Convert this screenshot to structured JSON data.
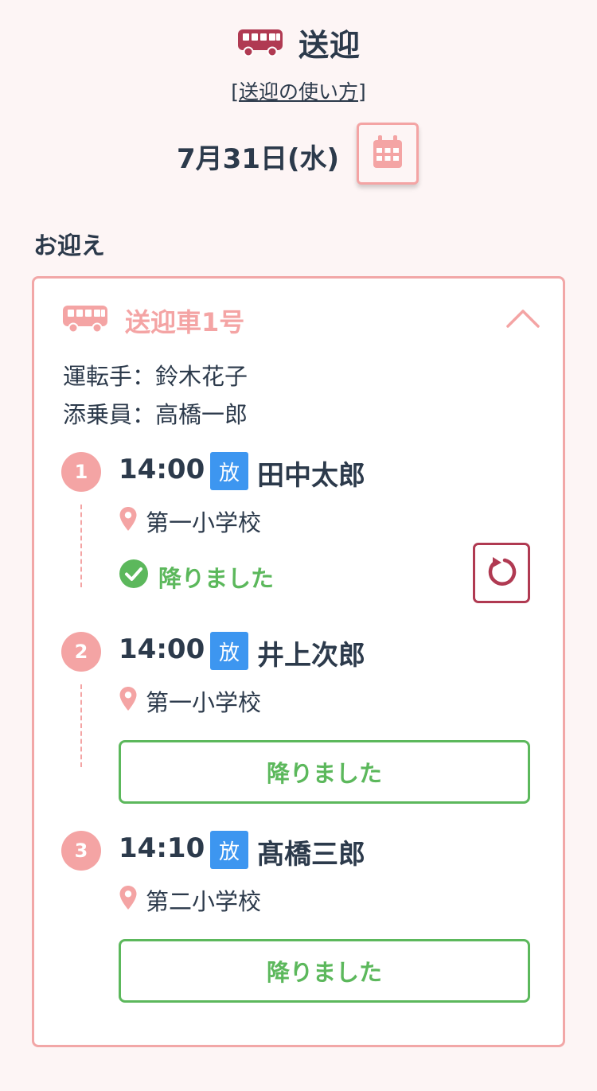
{
  "header": {
    "title": "送迎",
    "icon": "bus-icon"
  },
  "howto": {
    "open": "[",
    "link": "送迎の使い方",
    "close": "]"
  },
  "date": {
    "label": "7月31日(水)",
    "calendar_icon": "calendar-icon"
  },
  "section": {
    "title": "お迎え"
  },
  "car": {
    "name": "送迎車1号",
    "driver": "運転手：鈴木花子",
    "attendant": "添乗員：高橋一郎",
    "expanded": true
  },
  "stops": [
    {
      "number": "1",
      "time": "14:00",
      "badge": "放",
      "child": "田中太郎",
      "school": "第一小学校",
      "status": "降りました",
      "completed": true
    },
    {
      "number": "2",
      "time": "14:00",
      "badge": "放",
      "child": "井上次郎",
      "school": "第一小学校",
      "button": "降りました",
      "completed": false
    },
    {
      "number": "3",
      "time": "14:10",
      "badge": "放",
      "child": "髙橋三郎",
      "school": "第二小学校",
      "button": "降りました",
      "completed": false
    }
  ],
  "colors": {
    "accent_pink": "#f4a4a4",
    "dark_red": "#b03a52",
    "green": "#5cb85c",
    "badge_blue": "#3d96f0",
    "text": "#2c3a4b"
  }
}
